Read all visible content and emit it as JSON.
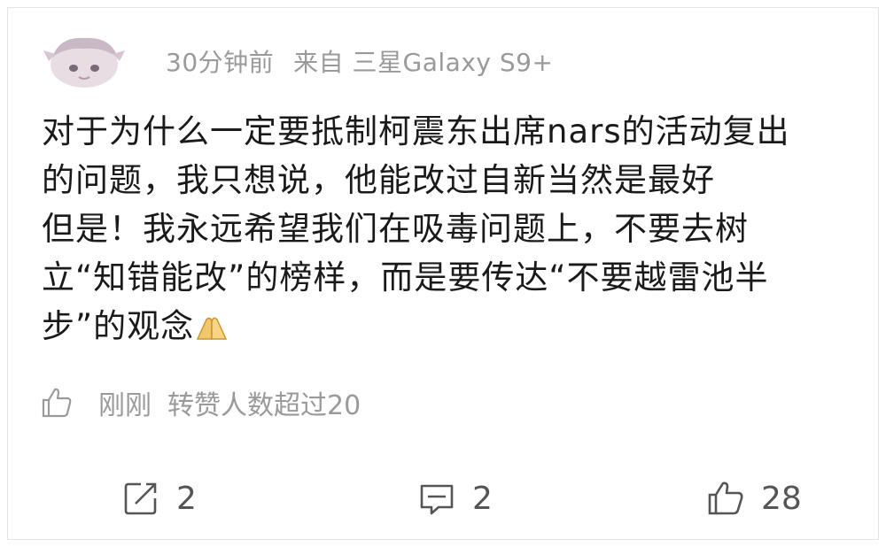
{
  "post": {
    "time": "30分钟前",
    "source": "来自 三星Galaxy S9+",
    "content_lines": [
      "对于为什么一定要抵制柯震东出席nars的活动复出",
      "的问题，我只想说，他能改过自新当然是最好",
      "但是！我永远希望我们在吸毒问题上，不要去树",
      "立“知错能改”的榜样，而是要传达“不要越雷池半",
      "步”的观念"
    ],
    "emoji": "praying-hands"
  },
  "status": {
    "time": "刚刚",
    "text": "转赞人数超过20"
  },
  "actions": {
    "repost_count": "2",
    "comment_count": "2",
    "like_count": "28"
  },
  "colors": {
    "text": "#1a1a1a",
    "muted": "#9a9a9a",
    "icon": "#555555"
  }
}
